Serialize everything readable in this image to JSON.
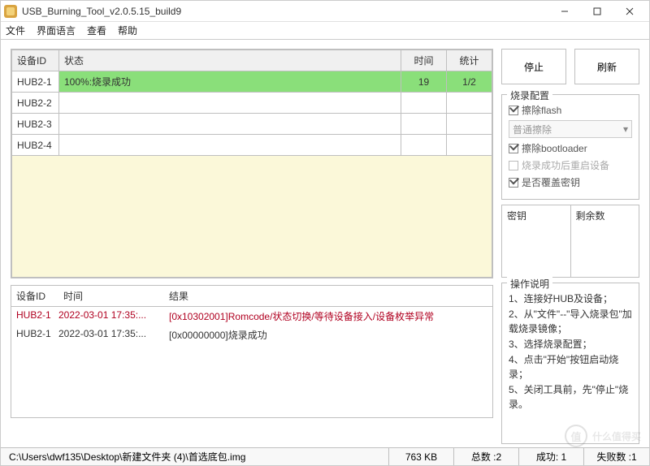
{
  "window": {
    "title": "USB_Burning_Tool_v2.0.5.15_build9"
  },
  "menu": {
    "file": "文件",
    "lang": "界面语言",
    "view": "查看",
    "help": "帮助"
  },
  "table": {
    "headers": {
      "id": "设备ID",
      "status": "状态",
      "time": "时间",
      "stat": "统计"
    },
    "rows": [
      {
        "id": "HUB2-1",
        "status": "100%:烧录成功",
        "time": "19",
        "stat": "1/2",
        "success": true
      },
      {
        "id": "HUB2-2",
        "status": "",
        "time": "",
        "stat": "",
        "success": false
      },
      {
        "id": "HUB2-3",
        "status": "",
        "time": "",
        "stat": "",
        "success": false
      },
      {
        "id": "HUB2-4",
        "status": "",
        "time": "",
        "stat": "",
        "success": false
      }
    ]
  },
  "log": {
    "headers": {
      "id": "设备ID",
      "time": "时间",
      "result": "结果"
    },
    "rows": [
      {
        "id": "HUB2-1",
        "time": "2022-03-01 17:35:...",
        "result": "[0x10302001]Romcode/状态切换/等待设备接入/设备枚举异常",
        "err": true
      },
      {
        "id": "HUB2-1",
        "time": "2022-03-01 17:35:...",
        "result": "[0x00000000]烧录成功",
        "err": false
      }
    ]
  },
  "buttons": {
    "stop": "停止",
    "refresh": "刷新"
  },
  "config": {
    "title": "烧录配置",
    "erase_flash": "擦除flash",
    "erase_mode": "普通擦除",
    "erase_bootloader": "擦除bootloader",
    "reboot": "烧录成功后重启设备",
    "overwrite_key": "是否覆盖密钥"
  },
  "keys": {
    "col1": "密钥",
    "col2": "剩余数"
  },
  "instructions": {
    "title": "操作说明",
    "steps": [
      "1、连接好HUB及设备；",
      "2、从\"文件\"--\"导入烧录包\"加载烧录镜像；",
      "3、选择烧录配置；",
      "4、点击\"开始\"按钮启动烧录；",
      "5、关闭工具前，先\"停止\"烧录。"
    ]
  },
  "status": {
    "path": "C:\\Users\\dwf135\\Desktop\\新建文件夹 (4)\\首选底包.img",
    "size": "763 KB",
    "total": "总数 :2",
    "success": "成功: 1",
    "fail": "失败数 :1"
  },
  "watermark": {
    "icon": "值",
    "text": "什么值得买"
  }
}
